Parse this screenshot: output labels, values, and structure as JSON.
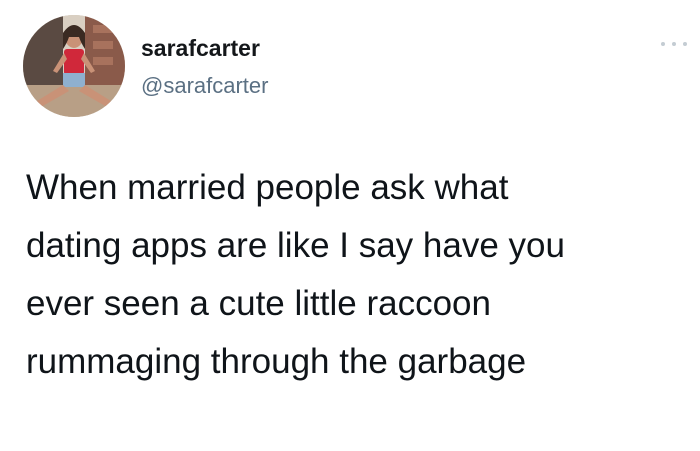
{
  "author": {
    "display_name": "sarafcarter",
    "handle": "@sarafcarter",
    "avatar_icon": "profile-photo"
  },
  "menu": {
    "icon": "more-horizontal-icon"
  },
  "tweet": {
    "lines": [
      "When married people ask what",
      "dating apps are like I say have you",
      "ever seen a cute little raccoon",
      "rummaging through the garbage"
    ]
  }
}
